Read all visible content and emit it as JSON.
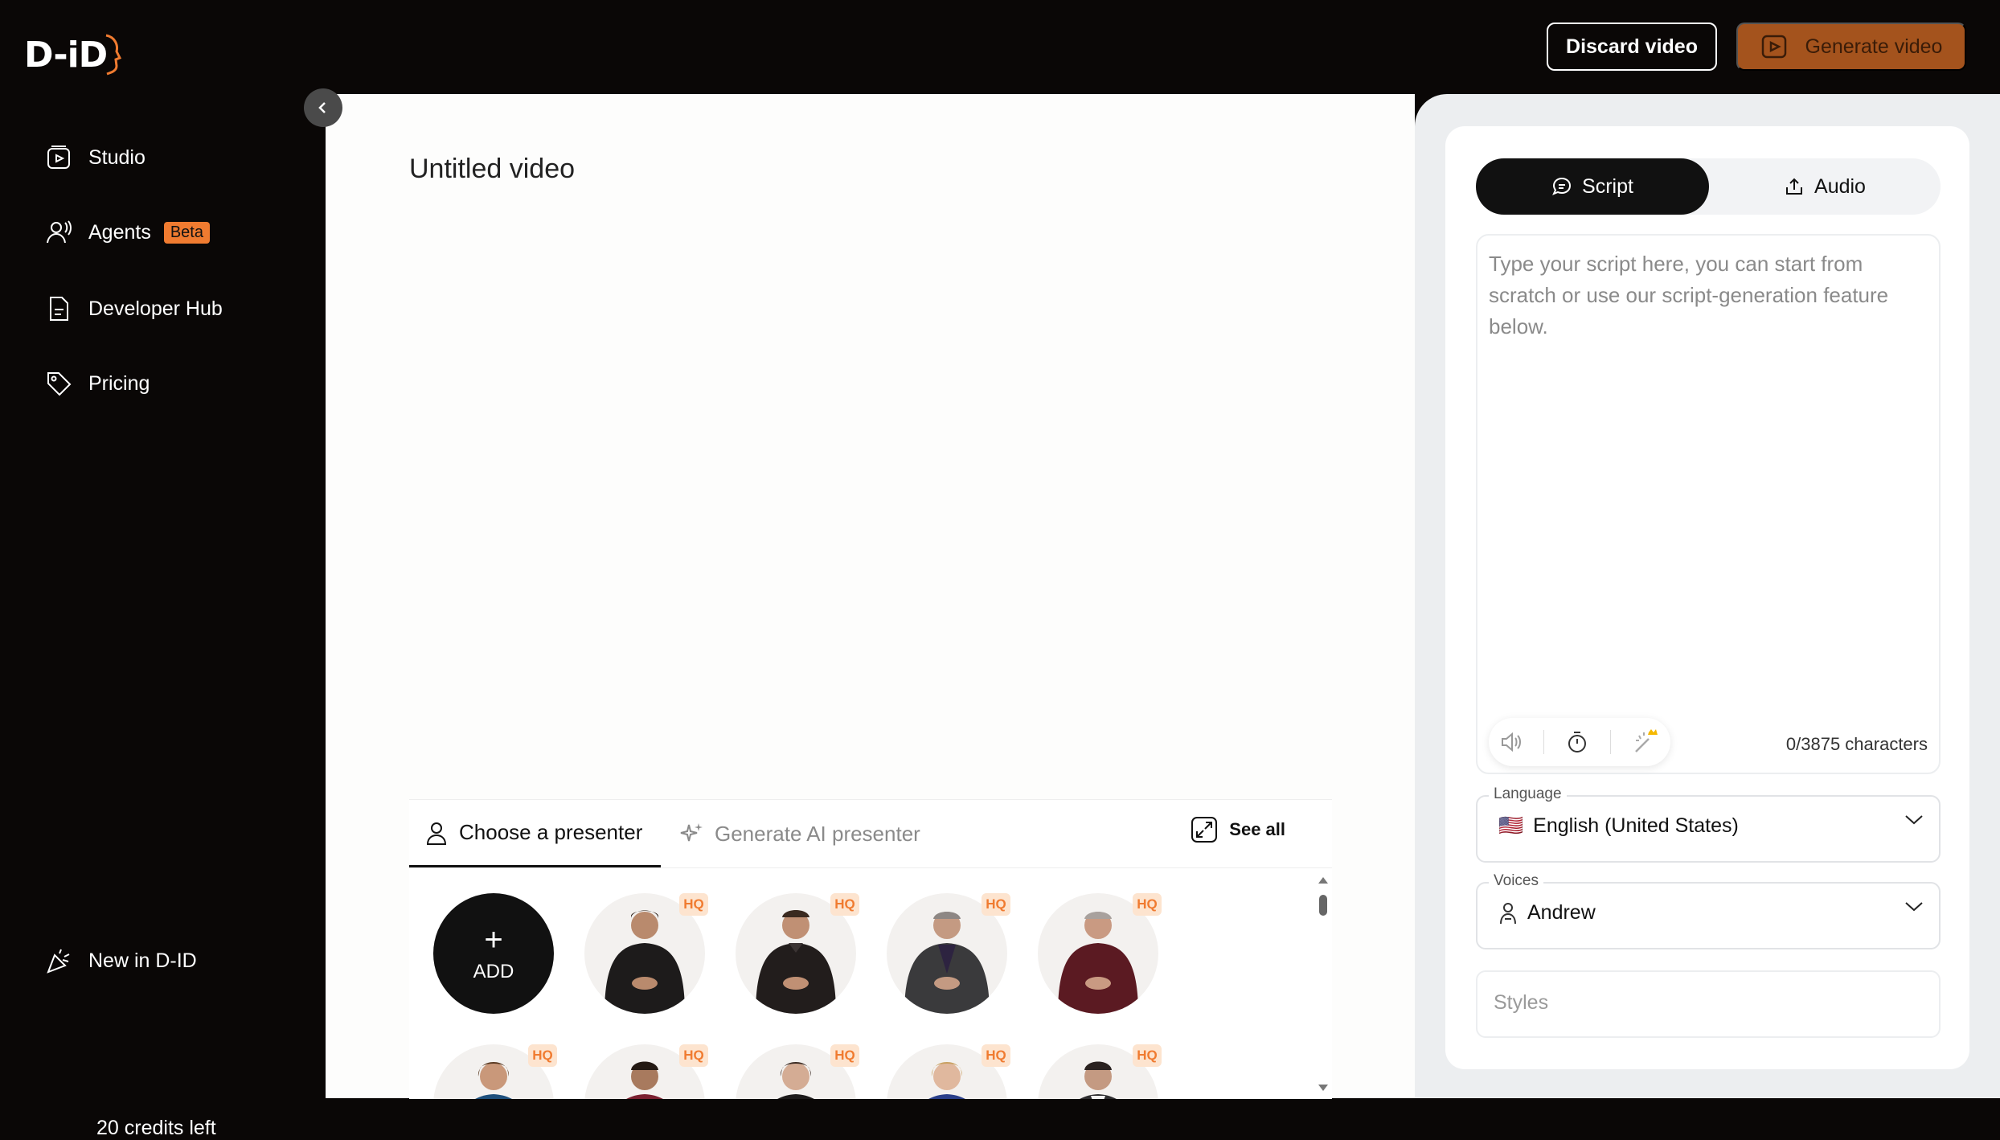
{
  "app": {
    "logo_text": "D-iD"
  },
  "header": {
    "discard_label": "Discard video",
    "generate_label": "Generate video"
  },
  "sidebar": {
    "items": [
      {
        "label": "Studio",
        "icon": "studio-icon"
      },
      {
        "label": "Agents",
        "icon": "agents-icon",
        "badge": "Beta"
      },
      {
        "label": "Developer Hub",
        "icon": "document-icon"
      },
      {
        "label": "Pricing",
        "icon": "tag-icon"
      }
    ],
    "news_label": "New in D-ID",
    "credits_label": "20 credits left"
  },
  "main": {
    "title": "Untitled video",
    "presenter_tabs": [
      {
        "label": "Choose a presenter",
        "icon": "person-icon",
        "active": true
      },
      {
        "label": "Generate AI presenter",
        "icon": "sparkle-icon",
        "active": false
      }
    ],
    "see_all_label": "See all",
    "add_label": "ADD",
    "hq_badge": "HQ"
  },
  "editor": {
    "tabs": [
      {
        "label": "Script",
        "icon": "chat-icon",
        "active": true
      },
      {
        "label": "Audio",
        "icon": "upload-icon",
        "active": false
      }
    ],
    "script_placeholder": "Type your script here, you can start from scratch or use our script-generation feature below.",
    "char_count": "0/3875 characters",
    "language": {
      "label": "Language",
      "flag": "🇺🇸",
      "value": "English (United States)"
    },
    "voices": {
      "label": "Voices",
      "value": "Andrew"
    },
    "styles_placeholder": "Styles"
  },
  "colors": {
    "accent": "#f07b30",
    "generate_btn": "#a4531d",
    "dark": "#0a0706"
  }
}
